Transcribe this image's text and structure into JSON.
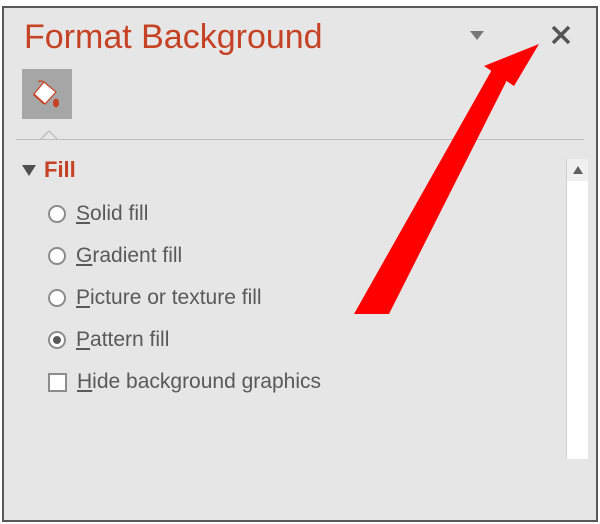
{
  "pane": {
    "title": "Format Background",
    "section": {
      "label": "Fill",
      "options": [
        {
          "label": "Solid fill",
          "selected": false
        },
        {
          "label": "Gradient fill",
          "selected": false
        },
        {
          "label": "Picture or texture fill",
          "selected": false
        },
        {
          "label": "Pattern fill",
          "selected": true
        }
      ],
      "checkbox": {
        "label": "Hide background graphics",
        "checked": false
      }
    }
  },
  "icons": {
    "dropdown": "chevron-down-icon",
    "close": "close-icon",
    "fill_tab": "paint-bucket-icon",
    "scroll_up": "scroll-up-icon"
  }
}
